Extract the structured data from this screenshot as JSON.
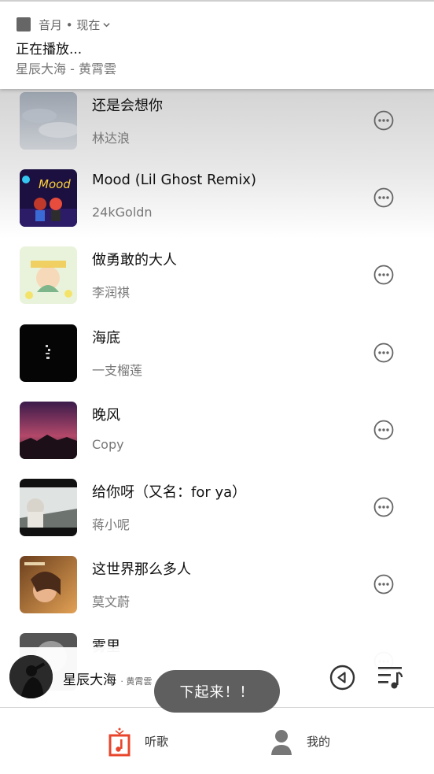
{
  "notification": {
    "app_line": "音月 • 现在",
    "title": "正在播放...",
    "subtitle": "星辰大海 - 黄霄雲"
  },
  "songs": [
    {
      "title": "还是会想你",
      "artist": "林达浪"
    },
    {
      "title": "Mood (Lil Ghost Remix)",
      "artist": "24kGoldn"
    },
    {
      "title": "做勇敢的大人",
      "artist": "李润祺"
    },
    {
      "title": "海底",
      "artist": "一支榴莲"
    },
    {
      "title": "晚风",
      "artist": "Copy"
    },
    {
      "title": "给你呀（又名：for ya）",
      "artist": "蒋小呢"
    },
    {
      "title": "这世界那么多人",
      "artist": "莫文蔚"
    },
    {
      "title": "雾里",
      "artist": ""
    }
  ],
  "now_playing": {
    "title": "星辰大海",
    "artist": "· 黄霄雲"
  },
  "toast": "下起来！！",
  "nav": {
    "listen_label": "听歌",
    "me_label": "我的"
  },
  "colors": {
    "accent": "#e8452c",
    "icon_gray": "#666666"
  }
}
